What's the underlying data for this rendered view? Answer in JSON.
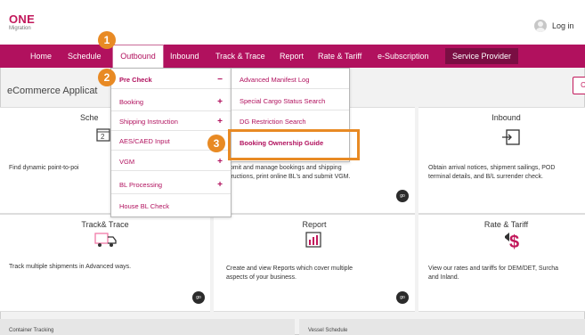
{
  "logo": {
    "line1": "ONE",
    "line2": "Migration"
  },
  "account": {
    "login_label": "Log in"
  },
  "nav": {
    "items": [
      "Home",
      "Schedule",
      "Outbound",
      "Inbound",
      "Track & Trace",
      "Report",
      "Rate & Tariff",
      "e-Subscription"
    ],
    "service_provider": "Service Provider",
    "active": "Outbound"
  },
  "page": {
    "subtitle": "eCommerce Applicat",
    "right_button": "C"
  },
  "outbound_menu": [
    {
      "label": "Pre Check",
      "mark": "−",
      "bold": true
    },
    {
      "label": "Booking",
      "mark": "+"
    },
    {
      "label": "Shipping Instruction",
      "mark": "+"
    },
    {
      "label": "AES/CAED Input",
      "mark": ""
    },
    {
      "label": "VGM",
      "mark": "+"
    },
    {
      "label": "BL Processing",
      "mark": "+"
    },
    {
      "label": "House BL Check",
      "mark": ""
    }
  ],
  "precheck_menu": [
    {
      "label": "Advanced Manifest Log"
    },
    {
      "label": "Special Cargo Status Search"
    },
    {
      "label": "DG Restriction Search"
    },
    {
      "label": "Booking Ownership Guide"
    }
  ],
  "cards": {
    "schedule": {
      "title": "Sche",
      "desc": "Find dynamic point-to-poi"
    },
    "outbound": {
      "desc": "ubmit and manage bookings and shipping\nstructions, print online BL's and submit VGM.",
      "go": "go"
    },
    "inbound": {
      "title": "Inbound",
      "desc": "Obtain arrival notices, shipment sailings, POD\nterminal details, and B/L surrender check."
    },
    "track": {
      "title": "Track& Trace",
      "desc": "Track multiple shipments in Advanced ways.",
      "go": "go"
    },
    "report": {
      "title": "Report",
      "desc": "Create and view Reports which cover multiple\naspects of your business.",
      "go": "go"
    },
    "rate": {
      "title": "Rate & Tariff",
      "desc": "View our rates and tariffs for DEM/DET, Surcha\nand Inland."
    }
  },
  "bottom": {
    "left": "Container Tracking",
    "right": "Vessel Schedule"
  },
  "steps": [
    "1",
    "2",
    "3"
  ],
  "colors": {
    "brand": "#b1115e",
    "highlight": "#e88a24"
  }
}
